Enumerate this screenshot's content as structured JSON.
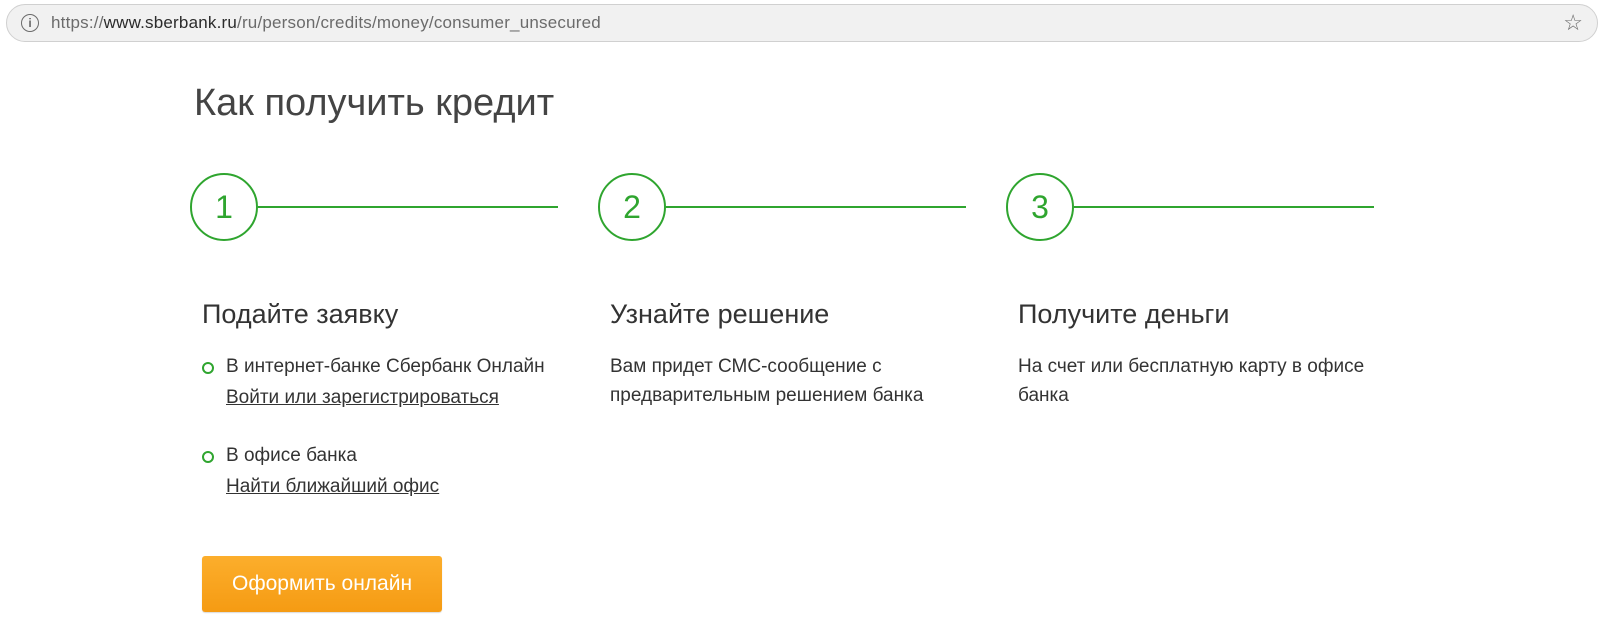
{
  "browser": {
    "url_proto": "https://",
    "url_host": "www.sberbank.ru",
    "url_path": "/ru/person/credits/money/consumer_unsecured"
  },
  "page": {
    "title": "Как получить кредит",
    "cta_label": "Оформить онлайн"
  },
  "steps": [
    {
      "num": "1",
      "title": "Подайте заявку",
      "items": [
        {
          "text": "В интернет-банке Сбербанк Онлайн",
          "link": "Войти или зарегистрироваться"
        },
        {
          "text": "В офисе банка",
          "link": "Найти ближайший офис"
        }
      ]
    },
    {
      "num": "2",
      "title": "Узнайте решение",
      "desc": "Вам придет СМС-сообщение с предварительным решением банка"
    },
    {
      "num": "3",
      "title": "Получите деньги",
      "desc": "На счет или бесплатную карту в офисе банка"
    }
  ]
}
